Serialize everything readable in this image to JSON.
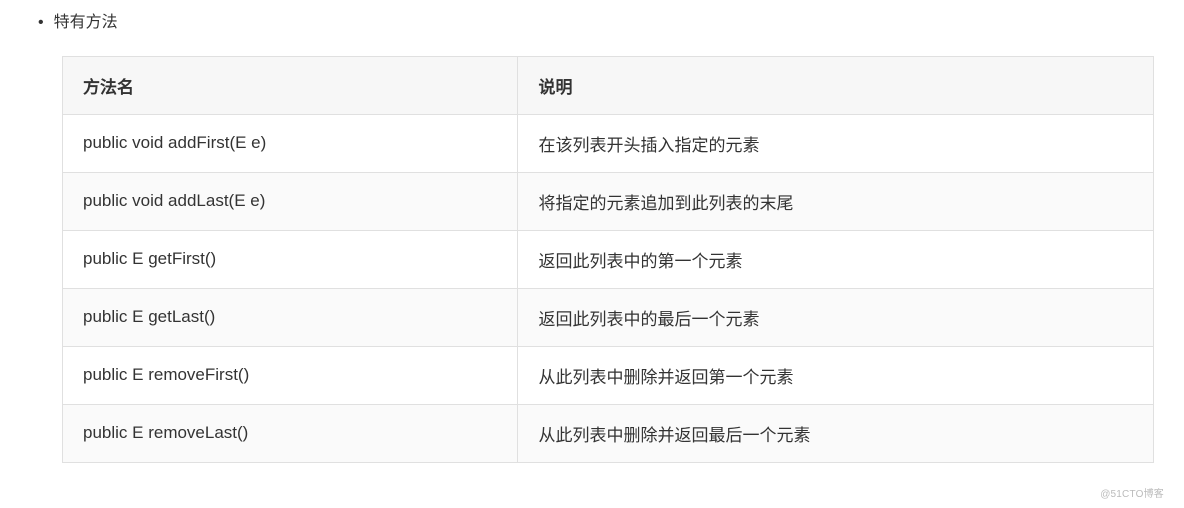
{
  "bullet": {
    "label": "特有方法"
  },
  "table": {
    "headers": {
      "method": "方法名",
      "desc": "说明"
    },
    "rows": [
      {
        "method": "public void addFirst(E e)",
        "desc": "在该列表开头插入指定的元素"
      },
      {
        "method": "public void addLast(E e)",
        "desc": "将指定的元素追加到此列表的末尾"
      },
      {
        "method": "public E getFirst()",
        "desc": "返回此列表中的第一个元素"
      },
      {
        "method": "public E getLast()",
        "desc": "返回此列表中的最后一个元素"
      },
      {
        "method": "public E removeFirst()",
        "desc": "从此列表中删除并返回第一个元素"
      },
      {
        "method": "public E removeLast()",
        "desc": "从此列表中删除并返回最后一个元素"
      }
    ]
  },
  "watermark": "@51CTO博客"
}
